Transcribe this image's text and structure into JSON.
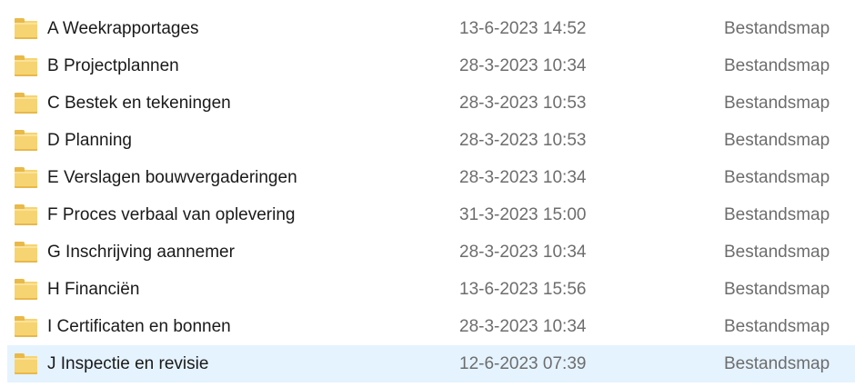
{
  "rows": [
    {
      "name": "A Weekrapportages",
      "date": "13-6-2023 14:52",
      "type": "Bestandsmap",
      "icon": "folder-icon"
    },
    {
      "name": "B Projectplannen",
      "date": "28-3-2023 10:34",
      "type": "Bestandsmap",
      "icon": "folder-icon"
    },
    {
      "name": "C Bestek en tekeningen",
      "date": "28-3-2023 10:53",
      "type": "Bestandsmap",
      "icon": "folder-icon"
    },
    {
      "name": "D Planning",
      "date": "28-3-2023 10:53",
      "type": "Bestandsmap",
      "icon": "folder-icon"
    },
    {
      "name": "E Verslagen bouwvergaderingen",
      "date": "28-3-2023 10:34",
      "type": "Bestandsmap",
      "icon": "folder-icon"
    },
    {
      "name": "F Proces verbaal van oplevering",
      "date": "31-3-2023 15:00",
      "type": "Bestandsmap",
      "icon": "folder-icon"
    },
    {
      "name": "G Inschrijving aannemer",
      "date": "28-3-2023 10:34",
      "type": "Bestandsmap",
      "icon": "folder-icon"
    },
    {
      "name": "H Financiën",
      "date": "13-6-2023 15:56",
      "type": "Bestandsmap",
      "icon": "folder-icon"
    },
    {
      "name": "I Certificaten en bonnen",
      "date": "28-3-2023 10:34",
      "type": "Bestandsmap",
      "icon": "folder-icon"
    },
    {
      "name": "J Inspectie en revisie",
      "date": "12-6-2023 07:39",
      "type": "Bestandsmap",
      "icon": "folder-icon",
      "selected": true
    }
  ],
  "colors": {
    "selection": "#e5f3ff",
    "folder": "#f7d472",
    "text": "#1a1a1a",
    "secondary_text": "#6d6d6d"
  }
}
